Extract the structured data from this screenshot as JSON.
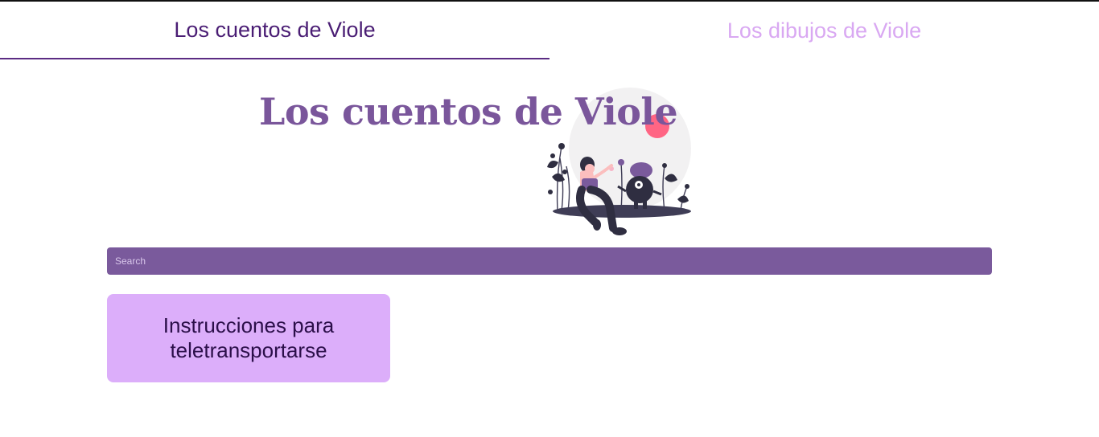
{
  "nav": {
    "tabs": [
      {
        "label": "Los cuentos de Viole",
        "active": true
      },
      {
        "label": "Los dibujos de Viole",
        "active": false
      }
    ]
  },
  "hero": {
    "title": "Los cuentos de Viole",
    "illustration": "person-with-monster-illustration"
  },
  "search": {
    "placeholder": "Search",
    "value": ""
  },
  "stories": [
    {
      "title": "Instrucciones para teletransportarse"
    }
  ],
  "colors": {
    "accent": "#7a5a9c",
    "active_tab": "#4a1d74",
    "inactive_tab": "#d9a8f2",
    "card_bg": "#dcaefa",
    "card_text": "#2b0f49",
    "hero_title": "#7a569b"
  }
}
